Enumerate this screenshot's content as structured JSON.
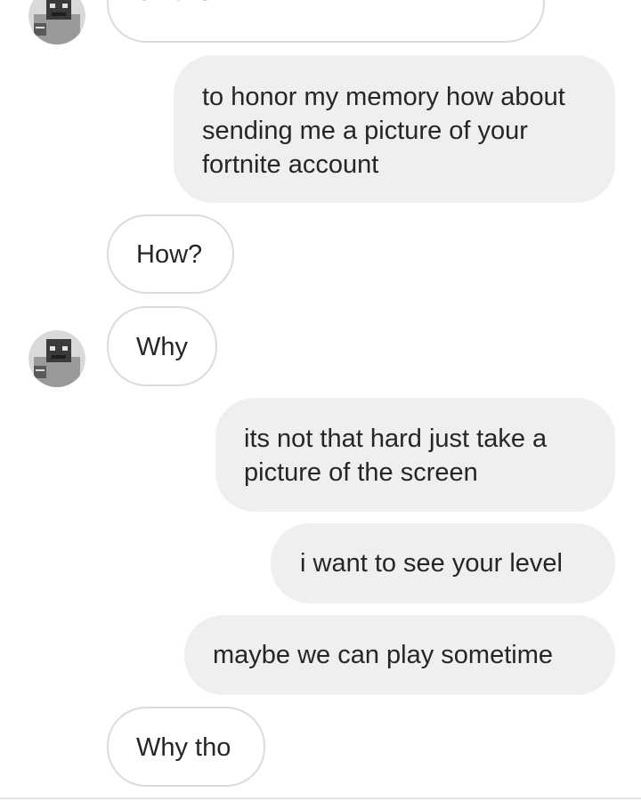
{
  "conversation": {
    "messages": [
      {
        "sender": "them",
        "text": "emails"
      },
      {
        "sender": "me",
        "text": "to honor my memory how about sending me a picture of your fortnite account"
      },
      {
        "sender": "them",
        "text": "How?"
      },
      {
        "sender": "them",
        "text": "Why"
      },
      {
        "sender": "me",
        "text": "its not that hard just take a picture of the screen"
      },
      {
        "sender": "me",
        "text": "i want to see your level"
      },
      {
        "sender": "me",
        "text": "maybe we can play sometime"
      },
      {
        "sender": "them",
        "text": "Why tho"
      }
    ]
  },
  "avatar": {
    "icon": "contact-avatar-icon"
  },
  "colors": {
    "outgoing_bubble": "#efefef",
    "incoming_border": "#dbdbdb",
    "text": "#262626"
  }
}
